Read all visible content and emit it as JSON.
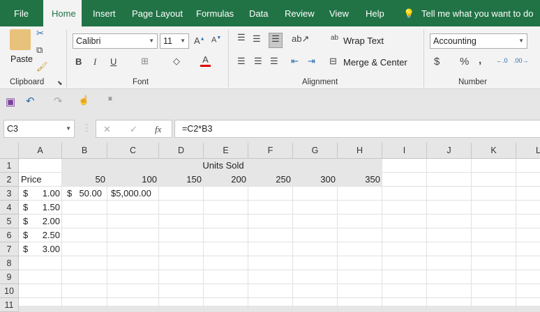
{
  "tabs": [
    "File",
    "Home",
    "Insert",
    "Page Layout",
    "Formulas",
    "Data",
    "Review",
    "View",
    "Help"
  ],
  "active_tab": "Home",
  "tell_me": "Tell me what you want to do",
  "ribbon": {
    "clipboard": {
      "paste": "Paste",
      "label": "Clipboard"
    },
    "font": {
      "name": "Calibri",
      "size": "11",
      "bold": "B",
      "italic": "I",
      "underline": "U",
      "label": "Font"
    },
    "alignment": {
      "wrap": "Wrap Text",
      "merge": "Merge & Center",
      "label": "Alignment"
    },
    "number": {
      "format": "Accounting",
      "currency": "$",
      "percent": "%",
      "comma": ",",
      "label": "Number"
    }
  },
  "formula_bar": {
    "name_box": "C3",
    "formula": "=C2*B3",
    "fx": "fx"
  },
  "columns": [
    "A",
    "B",
    "C",
    "D",
    "E",
    "F",
    "G",
    "H",
    "I",
    "J",
    "K",
    "L"
  ],
  "rows": [
    "1",
    "2",
    "3",
    "4",
    "5",
    "6",
    "7",
    "8",
    "9",
    "10",
    "11"
  ],
  "cells": {
    "header_units": "Units Sold",
    "A2": "Price",
    "row2_units": [
      "50",
      "100",
      "150",
      "200",
      "250",
      "300",
      "350"
    ],
    "prices": [
      {
        "sym": "$",
        "val": "1.00"
      },
      {
        "sym": "$",
        "val": "1.50"
      },
      {
        "sym": "$",
        "val": "2.00"
      },
      {
        "sym": "$",
        "val": "2.50"
      },
      {
        "sym": "$",
        "val": "3.00"
      }
    ],
    "B3": {
      "sym": "$",
      "val": "50.00"
    },
    "C3": "$5,000.00"
  },
  "colors": {
    "brand": "#217346",
    "font_color": "#e00000"
  }
}
